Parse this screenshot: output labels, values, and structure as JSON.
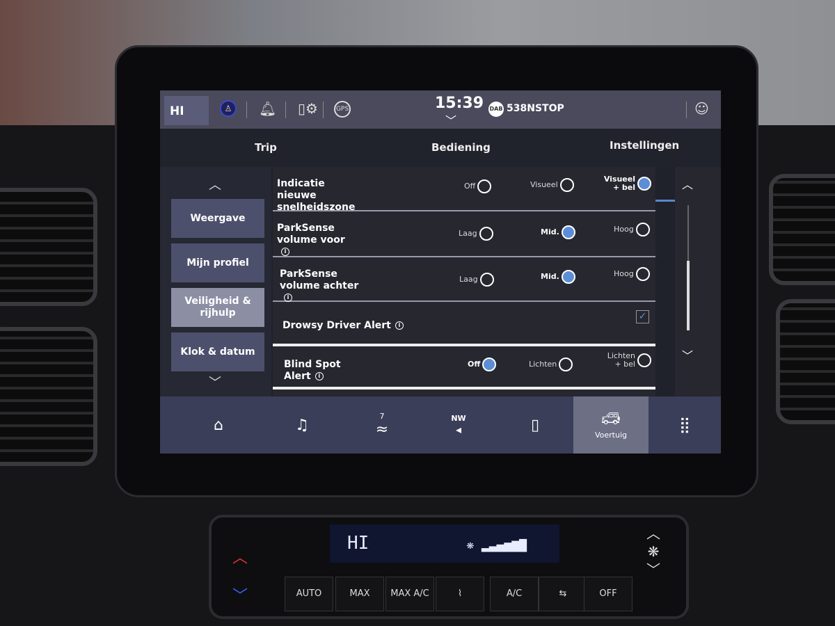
{
  "status": {
    "profile": "HI",
    "time": "15:39",
    "source": "DAB",
    "station": "538NSTOP",
    "icons": [
      "driver-profile-icon",
      "bell-icon",
      "phone-settings-icon",
      "gps-icon",
      "voice-assistant-icon"
    ]
  },
  "tabs": [
    {
      "label": "Trip"
    },
    {
      "label": "Bediening"
    },
    {
      "label": "Instellingen",
      "active": true
    }
  ],
  "sidebar": {
    "items": [
      {
        "label": "Weergave"
      },
      {
        "label": "Mijn profiel"
      },
      {
        "label": "Veiligheid & rijhulp",
        "selected": true
      },
      {
        "label": "Klok & datum"
      }
    ]
  },
  "settings": [
    {
      "label": "Indicatie nieuwe snelheidszone",
      "info": false,
      "options": [
        "Off",
        "Visueel",
        "Visueel + bel"
      ],
      "selected": 2
    },
    {
      "label": "ParkSense volume voor",
      "info": true,
      "options": [
        "Laag",
        "Mid.",
        "Hoog"
      ],
      "selected": 1
    },
    {
      "label": "ParkSense volume achter",
      "info": true,
      "options": [
        "Laag",
        "Mid.",
        "Hoog"
      ],
      "selected": 1
    },
    {
      "label": "Drowsy Driver Alert",
      "info": true,
      "checked": true
    },
    {
      "label": "Blind Spot Alert",
      "info": true,
      "options": [
        "Off",
        "Lichten",
        "Lichten + bel"
      ],
      "selected": 0
    }
  ],
  "nav": {
    "items": [
      {
        "icon": "home-icon"
      },
      {
        "icon": "music-icon"
      },
      {
        "icon": "climate-icon",
        "badge": "7"
      },
      {
        "icon": "navigation-icon",
        "badge": "NW"
      },
      {
        "icon": "phone-icon"
      },
      {
        "icon": "vehicle-icon",
        "label": "Voertuig",
        "selected": true
      },
      {
        "icon": "apps-grid-icon"
      }
    ]
  },
  "climate": {
    "display": "HI",
    "buttons": [
      "AUTO",
      "MAX",
      "MAX A/C",
      "A/C",
      "OFF"
    ]
  },
  "colors": {
    "accent": "#5b8ed6",
    "statusbar": "#4a4a5c",
    "navbar": "#3b3e58"
  }
}
